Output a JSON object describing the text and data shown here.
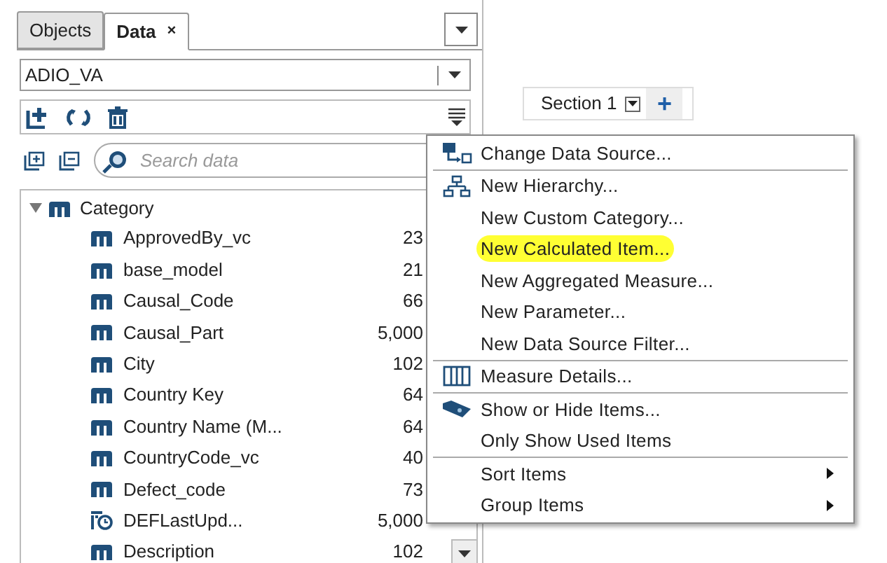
{
  "panel": {
    "tabs": [
      {
        "label": "Objects",
        "selected": false
      },
      {
        "label": "Data",
        "selected": true,
        "close": "×"
      }
    ],
    "data_source": {
      "value": "ADIO_VA"
    },
    "search": {
      "placeholder": "Search data"
    },
    "tree": {
      "label": "Category",
      "expanded": true,
      "children": [
        {
          "label": "ApprovedBy_vc",
          "count": "23",
          "kind": "category"
        },
        {
          "label": "base_model",
          "count": "21",
          "kind": "category"
        },
        {
          "label": "Causal_Code",
          "count": "66",
          "kind": "category"
        },
        {
          "label": "Causal_Part",
          "count": "5,000",
          "kind": "category"
        },
        {
          "label": "City",
          "count": "102",
          "kind": "category"
        },
        {
          "label": "Country Key",
          "count": "64",
          "kind": "category"
        },
        {
          "label": "Country Name (M...",
          "count": "64",
          "kind": "category"
        },
        {
          "label": "CountryCode_vc",
          "count": "40",
          "kind": "category"
        },
        {
          "label": "Defect_code",
          "count": "73",
          "kind": "category"
        },
        {
          "label": "DEFLastUpd...",
          "count": "5,000",
          "kind": "date"
        },
        {
          "label": "Description",
          "count": "102",
          "kind": "category"
        }
      ]
    }
  },
  "canvas": {
    "section_tab": {
      "label": "Section 1"
    },
    "add_button": "+"
  },
  "menu": {
    "groups": [
      [
        {
          "label": "Change Data Source...",
          "kind": "action",
          "highlighted": false
        }
      ],
      [
        {
          "label": "New Hierarchy...",
          "kind": "action",
          "highlighted": false
        },
        {
          "label": "New Custom Category...",
          "kind": "action",
          "highlighted": false
        },
        {
          "label": "New Calculated Item...",
          "kind": "action",
          "highlighted": true
        },
        {
          "label": "New Aggregated Measure...",
          "kind": "action",
          "highlighted": false
        },
        {
          "label": "New Parameter...",
          "kind": "action",
          "highlighted": false
        },
        {
          "label": "New Data Source Filter...",
          "kind": "action",
          "highlighted": false
        }
      ],
      [
        {
          "label": "Measure Details...",
          "kind": "action",
          "highlighted": false
        }
      ],
      [
        {
          "label": "Show or Hide Items...",
          "kind": "action",
          "highlighted": false
        },
        {
          "label": "Only Show Used Items",
          "kind": "action",
          "highlighted": false
        }
      ],
      [
        {
          "label": "Sort Items",
          "kind": "submenu",
          "highlighted": false
        },
        {
          "label": "Group Items",
          "kind": "submenu",
          "highlighted": false
        }
      ]
    ]
  }
}
